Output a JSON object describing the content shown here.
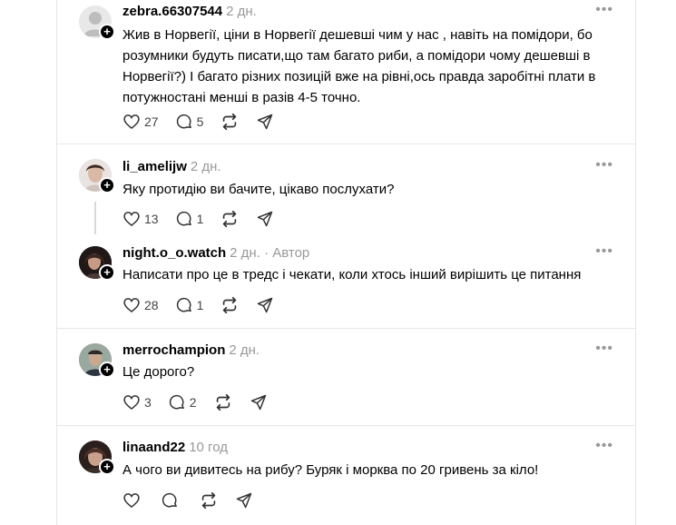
{
  "posts": [
    {
      "username": "zebra.66307544",
      "time": "2 дн.",
      "text": "Жив в Норвегії, ціни в Норвегії дешевші чим у нас , навіть на помідори, бо розумники будуть писати,що там багато риби, а помідори чому дешевші в Норвегії?) І багато різних позицій вже на рівні,ось правда заробітні плати в потужностані менші в разів 4-5 точно.",
      "likes": "27",
      "comments": "5"
    },
    {
      "username": "li_amelijw",
      "time": "2 дн.",
      "text": "Яку протидію ви бачите, цікаво послухати?",
      "likes": "13",
      "comments": "1"
    },
    {
      "username": "night.o_o.watch",
      "time": "2 дн.",
      "author_label": "· Автор",
      "text": "Написати про це в тредс і чекати, коли хтось інший вирішить це питання",
      "likes": "28",
      "comments": "1"
    },
    {
      "username": "merrochampion",
      "time": "2 дн.",
      "text": "Це дорого?",
      "likes": "3",
      "comments": "2"
    },
    {
      "username": "linaand22",
      "time": "10 год",
      "text": "А чого ви дивитесь на рибу? Буряк і морква по 20 гривень за кіло!",
      "likes": "",
      "comments": ""
    }
  ],
  "icons": {
    "more": "more-dots-icon",
    "like": "heart-icon",
    "comment": "comment-icon",
    "repost": "repost-icon",
    "share": "share-icon",
    "follow": "plus-icon"
  },
  "colors": {
    "muted": "#999999",
    "border": "#e6e6e6"
  }
}
